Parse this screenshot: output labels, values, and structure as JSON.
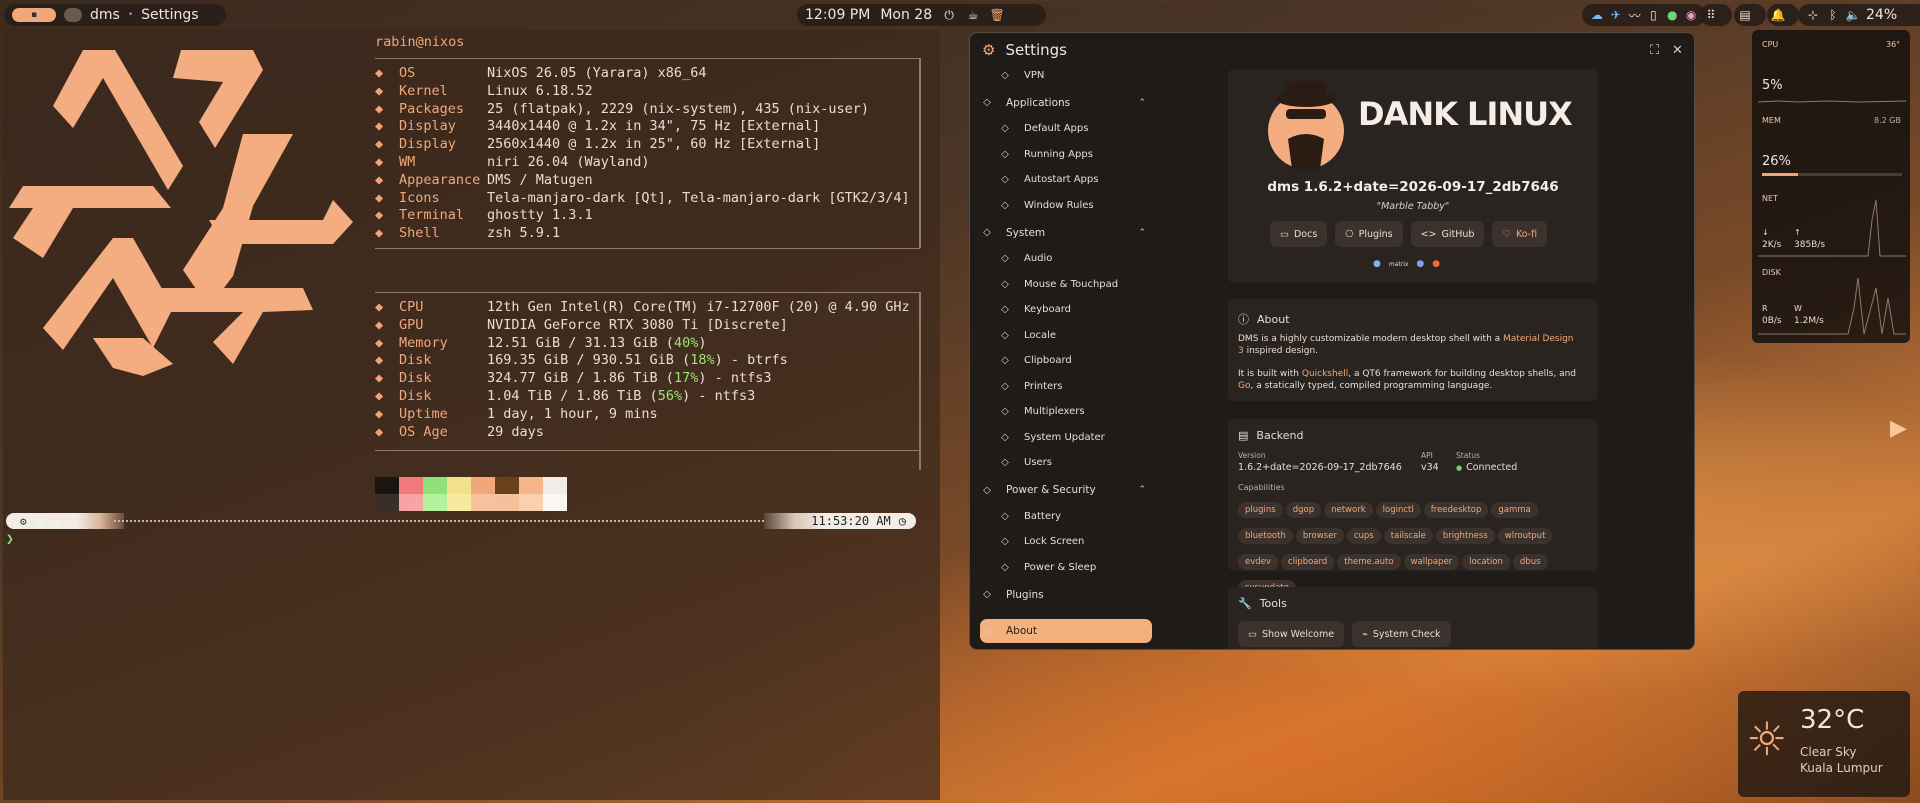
{
  "topbar": {
    "workspace_label": "dms",
    "window_title": "Settings",
    "clock": "12:09 PM",
    "date": "Mon 28",
    "battery": "24%"
  },
  "terminal": {
    "user_host": "rabin@nixos",
    "fastfetch": [
      {
        "key": "OS",
        "value": "NixOS 26.05 (Yarara) x86_64"
      },
      {
        "key": "Kernel",
        "value": "Linux 6.18.52"
      },
      {
        "key": "Packages",
        "value": "25 (flatpak), 2229 (nix-system), 435 (nix-user)"
      },
      {
        "key": "Display",
        "value": "3440x1440 @ 1.2x in 34\", 75 Hz [External]"
      },
      {
        "key": "Display",
        "value": "2560x1440 @ 1.2x in 25\", 60 Hz [External]"
      },
      {
        "key": "WM",
        "value": "niri 26.04 (Wayland)"
      },
      {
        "key": "Appearance",
        "value": "DMS / Matugen"
      },
      {
        "key": "Icons",
        "value": "Tela-manjaro-dark [Qt], Tela-manjaro-dark [GTK2/3/4]"
      },
      {
        "key": "Terminal",
        "value": "ghostty 1.3.1"
      },
      {
        "key": "Shell",
        "value": "zsh 5.9.1"
      }
    ],
    "hardware": [
      {
        "key": "CPU",
        "value": "12th Gen Intel(R) Core(TM) i7-12700F (20) @ 4.90 GHz"
      },
      {
        "key": "GPU",
        "value": "NVIDIA GeForce RTX 3080 Ti [Discrete]"
      },
      {
        "key": "Memory",
        "value_pre": "12.51 GiB / 31.13 GiB (",
        "value_hl": "40%",
        "value_post": ")"
      },
      {
        "key": "Disk",
        "value_pre": "169.35 GiB / 930.51 GiB (",
        "value_hl": "18%",
        "value_post": ") - btrfs"
      },
      {
        "key": "Disk",
        "value_pre": "324.77 GiB / 1.86 TiB (",
        "value_hl": "17%",
        "value_post": ") - ntfs3"
      },
      {
        "key": "Disk",
        "value_pre": "1.04 TiB / 1.86 TiB (",
        "value_hl": "56%",
        "value_post": ") - ntfs3"
      },
      {
        "key": "Uptime",
        "value": "1 day, 1 hour, 9 mins"
      },
      {
        "key": "OS Age",
        "value": "29 days"
      }
    ],
    "prompt_path": "~",
    "prompt_time": "11:53:20 AM",
    "palette": [
      "#1b1512",
      "#f07a7a",
      "#8fe07a",
      "#f3e08a",
      "#f1a878",
      "#6a3f1c",
      "#f7b58c",
      "#f2ece6",
      "#3a2e28",
      "#f8a4a4",
      "#b5f29d",
      "#f6ea9e",
      "#f7c39f",
      "#f6c09c",
      "#fad0b0",
      "#fbf6f2"
    ]
  },
  "settings": {
    "title": "Settings",
    "nav": [
      {
        "label": "VPN",
        "icon": "vpn-icon",
        "sub": true
      },
      {
        "label": "Applications",
        "icon": "apps-icon",
        "group": true
      },
      {
        "label": "Default Apps",
        "icon": "star-icon",
        "sub": true
      },
      {
        "label": "Running Apps",
        "icon": "running-icon",
        "sub": true
      },
      {
        "label": "Autostart Apps",
        "icon": "autostart-icon",
        "sub": true
      },
      {
        "label": "Window Rules",
        "icon": "window-icon",
        "sub": true
      },
      {
        "label": "System",
        "icon": "system-icon",
        "group": true
      },
      {
        "label": "Audio",
        "icon": "audio-icon",
        "sub": true
      },
      {
        "label": "Mouse & Touchpad",
        "icon": "mouse-icon",
        "sub": true
      },
      {
        "label": "Keyboard",
        "icon": "keyboard-icon",
        "sub": true
      },
      {
        "label": "Locale",
        "icon": "globe-icon",
        "sub": true
      },
      {
        "label": "Clipboard",
        "icon": "clipboard-icon",
        "sub": true
      },
      {
        "label": "Printers",
        "icon": "printer-icon",
        "sub": true
      },
      {
        "label": "Multiplexers",
        "icon": "terminal-icon",
        "sub": true
      },
      {
        "label": "System Updater",
        "icon": "refresh-icon",
        "sub": true
      },
      {
        "label": "Users",
        "icon": "user-icon",
        "sub": true
      },
      {
        "label": "Power & Security",
        "icon": "shield-icon",
        "group": true
      },
      {
        "label": "Battery",
        "icon": "battery-icon",
        "sub": true
      },
      {
        "label": "Lock Screen",
        "icon": "lock-icon",
        "sub": true
      },
      {
        "label": "Power & Sleep",
        "icon": "power-icon",
        "sub": true
      },
      {
        "label": "Plugins",
        "icon": "plugin-icon",
        "group": true
      },
      {
        "label": "About",
        "icon": "info-icon",
        "group": true,
        "active": true
      }
    ],
    "hero": {
      "logo_text": "DANK LINUX",
      "version": "dms 1.6.2+date=2026-09-17_2db7646",
      "codename": "\"Marble Tabby\"",
      "buttons": [
        "Docs",
        "Plugins",
        "GitHub",
        "Ko-fi"
      ],
      "matrix_label": "matrix"
    },
    "about": {
      "title": "About",
      "p1_a": "DMS is a highly customizable modern desktop shell with a ",
      "p1_link": "Material Design 3",
      "p1_b": " inspired design.",
      "p2_a": "It is built with ",
      "p2_link1": "Quickshell",
      "p2_b": ", a QT6 framework for building desktop shells, and ",
      "p2_link2": "Go",
      "p2_c": ", a statically typed, compiled programming language."
    },
    "backend": {
      "title": "Backend",
      "version_label": "Version",
      "version": "1.6.2+date=2026-09-17_2db7646",
      "api_label": "API",
      "api": "v34",
      "status_label": "Status",
      "status": "Connected",
      "capabilities_label": "Capabilities",
      "capabilities": [
        "plugins",
        "dgop",
        "network",
        "loginctl",
        "freedesktop",
        "gamma",
        "bluetooth",
        "browser",
        "cups",
        "tailscale",
        "brightness",
        "wlroutput",
        "evdev",
        "clipboard",
        "theme.auto",
        "wallpaper",
        "location",
        "dbus",
        "sysupdate"
      ]
    },
    "tools": {
      "title": "Tools",
      "buttons": [
        "Show Welcome",
        "System Check"
      ]
    }
  },
  "sysmon": {
    "cpu_label": "CPU",
    "cpu_temp": "36°",
    "cpu_pct": "5%",
    "mem_label": "MEM",
    "mem_total": "8.2 GB",
    "mem_pct": "26%",
    "net_label": "NET",
    "net_down": "2K/s",
    "net_up": "385B/s",
    "disk_label": "DISK",
    "disk_r_label": "R",
    "disk_w_label": "W",
    "disk_r": "0B/s",
    "disk_w": "1.2M/s"
  },
  "weather": {
    "temp": "32°C",
    "condition": "Clear Sky",
    "city": "Kuala Lumpur"
  }
}
